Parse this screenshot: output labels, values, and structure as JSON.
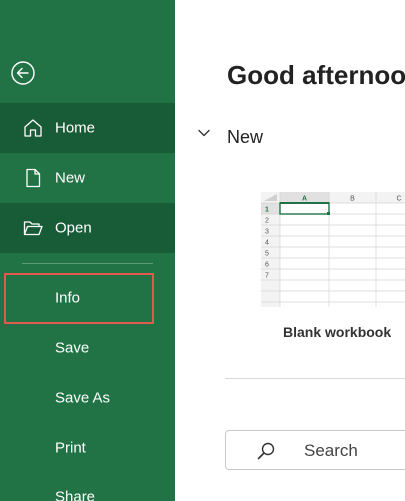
{
  "sidebar": {
    "back_icon": "back-arrow-icon",
    "items": [
      {
        "label": "Home",
        "icon": "home-icon",
        "active": true
      },
      {
        "label": "New",
        "icon": "new-document-icon"
      },
      {
        "label": "Open",
        "icon": "folder-open-icon"
      },
      {
        "label": "Info"
      },
      {
        "label": "Save"
      },
      {
        "label": "Save As"
      },
      {
        "label": "Print"
      },
      {
        "label": "Share"
      }
    ]
  },
  "main": {
    "greeting": "Good afternoo",
    "section_label": "New",
    "template": {
      "label": "Blank workbook",
      "columns": [
        "A",
        "B",
        "C"
      ],
      "rows": [
        "1",
        "2",
        "3",
        "4",
        "5",
        "6",
        "7"
      ]
    },
    "search": {
      "placeholder": "Search"
    }
  },
  "colors": {
    "sidebar_bg": "#217346",
    "sidebar_active": "#185c37",
    "highlight_outline": "#e05a4f"
  }
}
